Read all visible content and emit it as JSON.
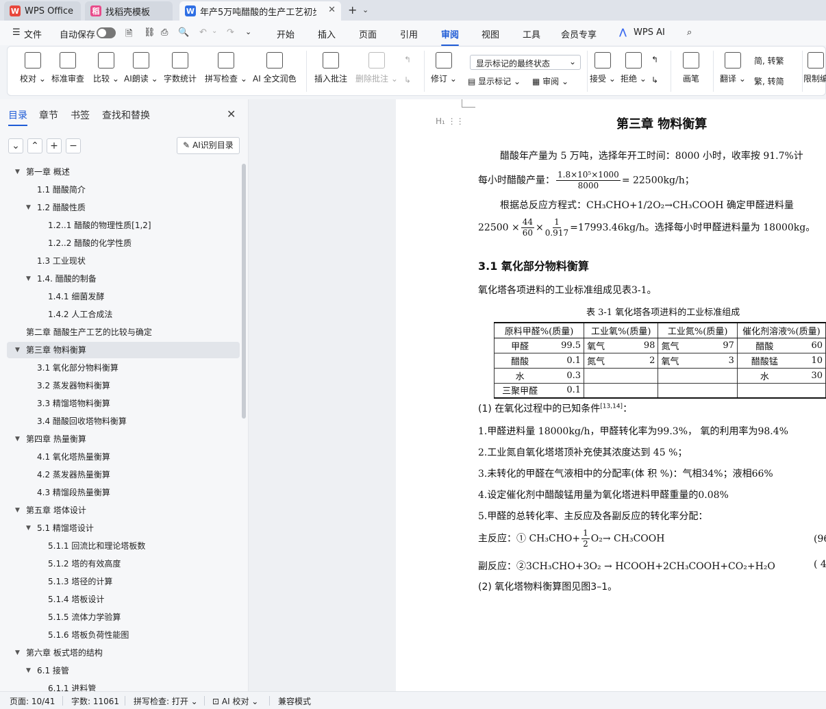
{
  "tabs": [
    {
      "label": "WPS Office",
      "color": "#e8473c"
    },
    {
      "label": "找稻壳模板",
      "color": "#e84a8a"
    },
    {
      "label": "年产5万吨醋酸的生产工艺初步",
      "color": "#2f6fe4",
      "icon": "W"
    }
  ],
  "menu": {
    "file": "文件",
    "autosave": "自动保存",
    "items": [
      "开始",
      "插入",
      "页面",
      "引用",
      "审阅",
      "视图",
      "工具",
      "会员专享",
      "WPS AI"
    ],
    "active": "审阅"
  },
  "ribbon": {
    "proof": "校对",
    "std_review": "标准审查",
    "compare": "比较",
    "ai_read": "AI朗读",
    "word_count": "字数统计",
    "spell": "拼写检查",
    "ai_polish": "AI 全文润色",
    "insert_comment": "插入批注",
    "delete_comment": "删除批注",
    "revise": "修订",
    "markup_mode": "显示标记的最终状态",
    "show_markup": "显示标记",
    "review_pane": "审阅",
    "accept": "接受",
    "reject": "拒绝",
    "pen": "画笔",
    "translate": "翻译",
    "to_traditional": "简, 转繁",
    "to_simplified": "繁, 转简",
    "restrict": "限制编"
  },
  "sidebar": {
    "tabs": [
      "目录",
      "章节",
      "书签",
      "查找和替换"
    ],
    "ai_toc": "AI识别目录",
    "toc": [
      {
        "text": "第一章  概述",
        "level": 0,
        "arrow": true
      },
      {
        "text": "1.1  醋酸简介",
        "level": 1,
        "arrow": false
      },
      {
        "text": "1.2  醋酸性质",
        "level": 1,
        "arrow": true
      },
      {
        "text": "1.2..1  醋酸的物理性质[1,2]",
        "level": 2,
        "arrow": false
      },
      {
        "text": "1.2..2  醋酸的化学性质",
        "level": 2,
        "arrow": false
      },
      {
        "text": "1.3  工业现状",
        "level": 1,
        "arrow": false
      },
      {
        "text": "1.4.  醋酸的制备",
        "level": 1,
        "arrow": true
      },
      {
        "text": "1.4.1  细菌发酵",
        "level": 2,
        "arrow": false
      },
      {
        "text": "1.4.2  人工合成法",
        "level": 2,
        "arrow": false
      },
      {
        "text": "第二章  醋酸生产工艺的比较与确定",
        "level": 0,
        "arrow": false
      },
      {
        "text": "第三章  物料衡算",
        "level": 0,
        "arrow": true,
        "selected": true
      },
      {
        "text": "3.1  氧化部分物料衡算",
        "level": 1,
        "arrow": false
      },
      {
        "text": "3.2 蒸发器物料衡算",
        "level": 1,
        "arrow": false
      },
      {
        "text": "3.3 精馏塔物料衡算",
        "level": 1,
        "arrow": false
      },
      {
        "text": "3.4  醋酸回收塔物料衡算",
        "level": 1,
        "arrow": false
      },
      {
        "text": "第四章  热量衡算",
        "level": 0,
        "arrow": true
      },
      {
        "text": "4.1  氧化塔热量衡算",
        "level": 1,
        "arrow": false
      },
      {
        "text": "4.2  蒸发器热量衡算",
        "level": 1,
        "arrow": false
      },
      {
        "text": "4.3  精馏段热量衡算",
        "level": 1,
        "arrow": false
      },
      {
        "text": "第五章  塔体设计",
        "level": 0,
        "arrow": true
      },
      {
        "text": "5.1  精馏塔设计",
        "level": 1,
        "arrow": true
      },
      {
        "text": "5.1.1  回流比和理论塔板数",
        "level": 2,
        "arrow": false
      },
      {
        "text": "5.1.2 塔的有效高度",
        "level": 2,
        "arrow": false
      },
      {
        "text": "5.1.3  塔径的计算",
        "level": 2,
        "arrow": false
      },
      {
        "text": "5.1.4  塔板设计",
        "level": 2,
        "arrow": false
      },
      {
        "text": "5.1.5  流体力学验算",
        "level": 2,
        "arrow": false
      },
      {
        "text": "5.1.6  塔板负荷性能图",
        "level": 2,
        "arrow": false
      },
      {
        "text": "第六章  板式塔的结构",
        "level": 0,
        "arrow": true
      },
      {
        "text": "6.1  接管",
        "level": 1,
        "arrow": true
      },
      {
        "text": "6.1.1  进料管",
        "level": 2,
        "arrow": false
      }
    ]
  },
  "doc": {
    "chapter": "第三章  物料衡算",
    "p1": "醋酸年产量为 5 万吨，选择年开工时间：8000 小时，收率按 91.7%计",
    "p2_label": "每小时醋酸产量：",
    "p2_num": "1.8×10⁵×1000",
    "p2_den": "8000",
    "p2_res": "= 22500kg/h；",
    "p3": "根据总反应方程式：CH₃CHO+1/2O₂→CH₃COOH 确定甲醛进料量",
    "p4_a": "22500 ×",
    "p4_f1n": "44",
    "p4_f1d": "60",
    "p4_x": "×",
    "p4_f2n": "1",
    "p4_f2d": "0.917",
    "p4_res": "=17993.46kg/h。选择每小时甲醛进料量为 18000kg。",
    "section": "3.1  氧化部分物料衡算",
    "p5": "氧化塔各项进料的工业标准组成见表3-1。",
    "table_caption": "表 3-1 氧化塔各项进料的工业标准组成",
    "table_headers": [
      "原料甲醛%(质量)",
      "工业氧%(质量)",
      "工业氮%(质量)",
      "催化剂溶液%(质量)"
    ],
    "table_rows": [
      [
        "甲醛",
        "99.5",
        "氧气",
        "98",
        "氮气",
        "97",
        "醋酸",
        "60"
      ],
      [
        "醋酸",
        "0.1",
        "氮气",
        "2",
        "氧气",
        "3",
        "醋酸锰",
        "10"
      ],
      [
        "水",
        "0.3",
        "",
        "",
        "",
        "",
        "水",
        "30"
      ],
      [
        "三聚甲醛",
        "0.1",
        "",
        "",
        "",
        "",
        "",
        ""
      ]
    ],
    "c1": "(1) 在氧化过程中的已知条件",
    "c1_ref": "[13,14]",
    "c1_end": "：",
    "c2": "1.甲醛进料量 18000kg/h，甲醛转化率为99.3%， 氧的利用率为98.4%",
    "c3": "2.工业氮自氧化塔塔顶补充使其浓度达到 45 %；",
    "c4": "3.未转化的甲醛在气液相中的分配率(体 积 %)：气相34%；液相66%",
    "c5": "4.设定催化剂中醋酸锰用量为氧化塔进料甲醛重量的0.08%",
    "c6": "5.甲醛的总转化率、主反应及各副反应的转化率分配：",
    "main_label": "主反应：① CH₃CHO+",
    "main_fn": "1",
    "main_fd": "2",
    "main_rest": "O₂→ CH₃COOH",
    "main_pct": "(96",
    "side": "副反应：②3CH₃CHO+3O₂ → HCOOH+2CH₃COOH+CO₂+H₂O",
    "side_pct": "( 4",
    "c7": "(2) 氧化塔物料衡算图见图3–1。"
  },
  "status": {
    "page": "页面: 10/41",
    "words": "字数: 11061",
    "spell": "拼写检查: 打开",
    "ai": "AI 校对",
    "compat": "兼容模式"
  }
}
